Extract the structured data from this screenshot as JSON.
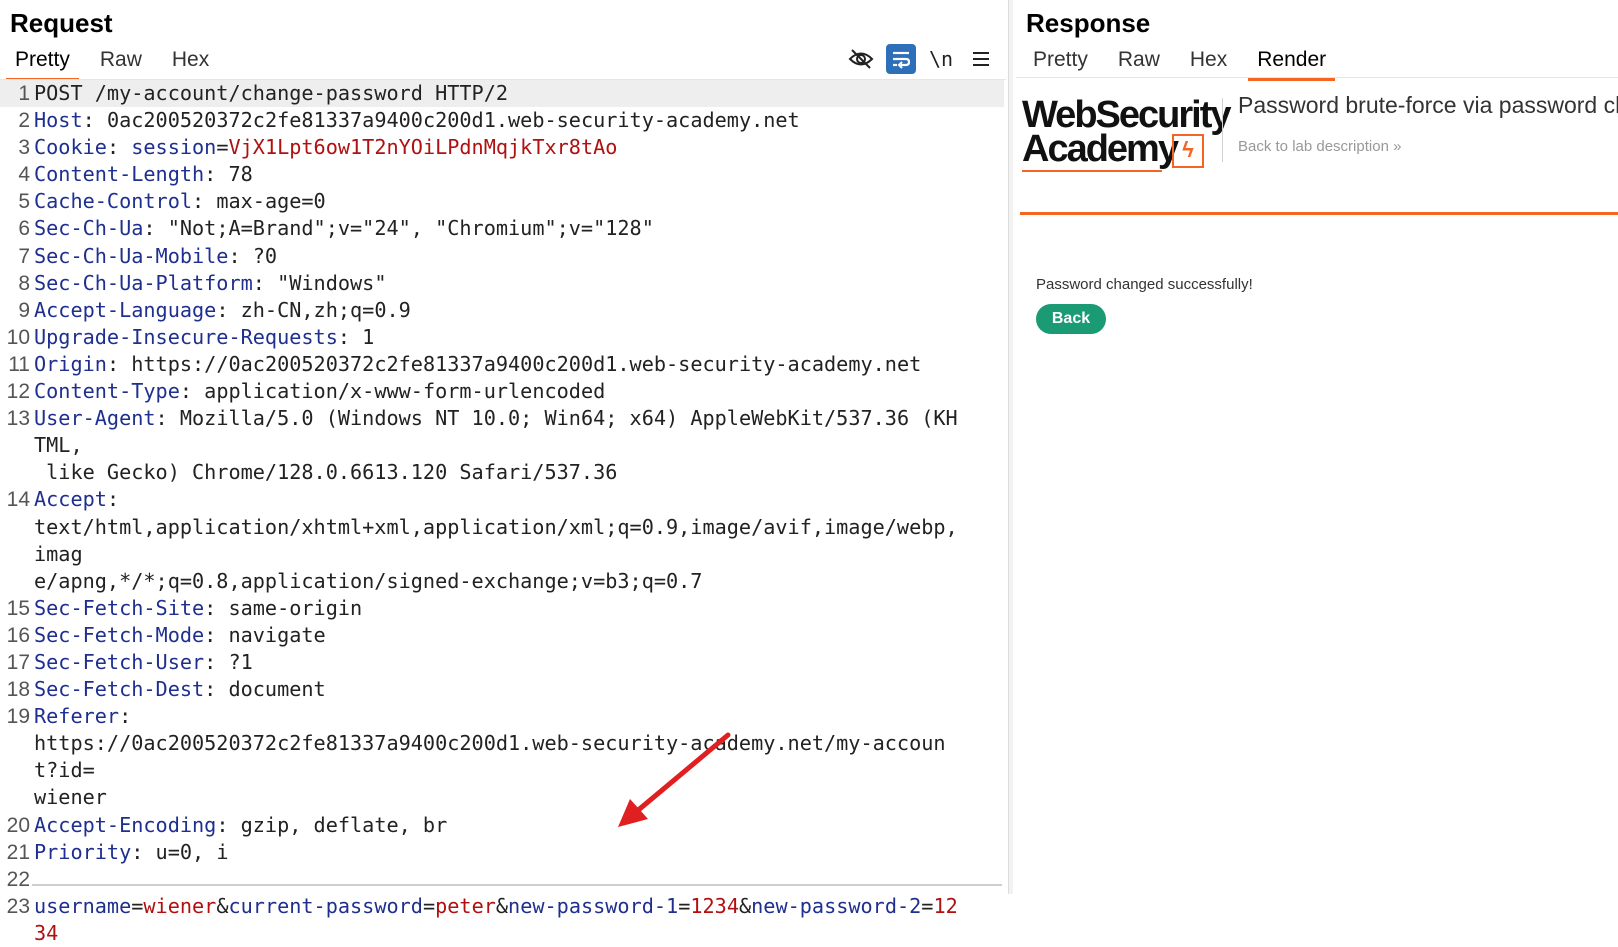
{
  "request": {
    "title": "Request",
    "tabs": [
      "Pretty",
      "Raw",
      "Hex"
    ],
    "active_tab": "Pretty",
    "toolbar": {
      "hide_icon": "eye-slash-icon",
      "wrap_icon": "word-wrap-icon",
      "newline_label": "\\n",
      "menu_icon": "hamburger-menu-icon"
    },
    "lines": {
      "l1": "POST /my-account/change-password HTTP/2",
      "l2k": "Host",
      "l2v": "0ac200520372c2fe81337a9400c200d1.web-security-academy.net",
      "l3k": "Cookie",
      "l3n": "session",
      "l3v": "VjX1Lpt6ow1T2nYOiLPdnMqjkTxr8tAo",
      "l4k": "Content-Length",
      "l4v": "78",
      "l5k": "Cache-Control",
      "l5v": "max-age=0",
      "l6k": "Sec-Ch-Ua",
      "l6v": "\"Not;A=Brand\";v=\"24\", \"Chromium\";v=\"128\"",
      "l7k": "Sec-Ch-Ua-Mobile",
      "l7v": "?0",
      "l8k": "Sec-Ch-Ua-Platform",
      "l8v": "\"Windows\"",
      "l9k": "Accept-Language",
      "l9v": "zh-CN,zh;q=0.9",
      "l10k": "Upgrade-Insecure-Requests",
      "l10v": "1",
      "l11k": "Origin",
      "l11v": "https://0ac200520372c2fe81337a9400c200d1.web-security-academy.net",
      "l12k": "Content-Type",
      "l12v": "application/x-www-form-urlencoded",
      "l13k": "User-Agent",
      "l13v": "Mozilla/5.0 (Windows NT 10.0; Win64; x64) AppleWebKit/537.36 (KHTML,",
      "l13v2": " like Gecko) Chrome/128.0.6613.120 Safari/537.36",
      "l14k": "Accept",
      "l14v": "text/html,application/xhtml+xml,application/xml;q=0.9,image/avif,image/webp,imag",
      "l14v2": "e/apng,*/*;q=0.8,application/signed-exchange;v=b3;q=0.7",
      "l15k": "Sec-Fetch-Site",
      "l15v": "same-origin",
      "l16k": "Sec-Fetch-Mode",
      "l16v": "navigate",
      "l17k": "Sec-Fetch-User",
      "l17v": "?1",
      "l18k": "Sec-Fetch-Dest",
      "l18v": "document",
      "l19k": "Referer",
      "l19v": "https://0ac200520372c2fe81337a9400c200d1.web-security-academy.net/my-account?id=",
      "l19v2": "wiener",
      "l20k": "Accept-Encoding",
      "l20v": "gzip, deflate, br",
      "l21k": "Priority",
      "l21v": "u=0, i",
      "body": {
        "p1": "username",
        "v1": "wiener",
        "p2": "current-password",
        "v2": "peter",
        "p3": "new-password-1",
        "v3": "1234",
        "p4": "new-password-2",
        "v4": "1234"
      }
    }
  },
  "response": {
    "title": "Response",
    "tabs": [
      "Pretty",
      "Raw",
      "Hex",
      "Render"
    ],
    "active_tab": "Render",
    "render": {
      "logo_line1": "WebSecurity",
      "logo_line2": "Academy",
      "lab_title": "Password brute-force via password change",
      "back_to_lab": "Back to lab description »",
      "message": "Password changed successfully!",
      "back_button": "Back"
    }
  },
  "colors": {
    "accent": "#f26522",
    "header_key": "#1f2f8f",
    "param_value": "#b01010",
    "button_green": "#1a9b74",
    "arrow": "#e02020"
  }
}
